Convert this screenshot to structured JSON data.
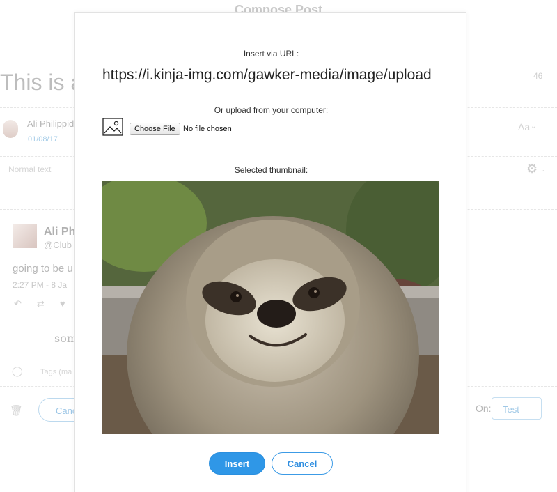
{
  "background": {
    "page_title": "Compose Post",
    "headline": "This is a",
    "char_count": "46",
    "author_name": "Ali Philippid",
    "author_date": "01/08/17",
    "typography_label": "Aa",
    "text_style": "Normal text",
    "tweet": {
      "name": "Ali Ph",
      "handle": "@Club",
      "text": "going to be u",
      "time": "2:27 PM - 8 Ja"
    },
    "body_fragment": "som",
    "tags_placeholder": "Tags (ma",
    "cancel_label": "Canc",
    "on_label": "On:",
    "test_label": "Test"
  },
  "modal": {
    "url_label": "Insert via URL:",
    "url_value": "https://i.kinja-img.com/gawker-media/image/upload",
    "upload_label": "Or upload from your computer:",
    "choose_file_label": "Choose File",
    "no_file_text": "No file chosen",
    "thumbnail_label": "Selected thumbnail:",
    "insert_label": "Insert",
    "cancel_label": "Cancel"
  },
  "icons": {
    "photo": "image-icon",
    "gear": "gear-icon",
    "tag": "tag-icon",
    "trash": "trash-icon",
    "reply": "reply-icon",
    "retweet": "retweet-icon",
    "like": "heart-icon"
  },
  "colors": {
    "accent": "#2f97e7",
    "accent_text": "#2f8ee0",
    "muted_blue": "#a6cde8"
  }
}
